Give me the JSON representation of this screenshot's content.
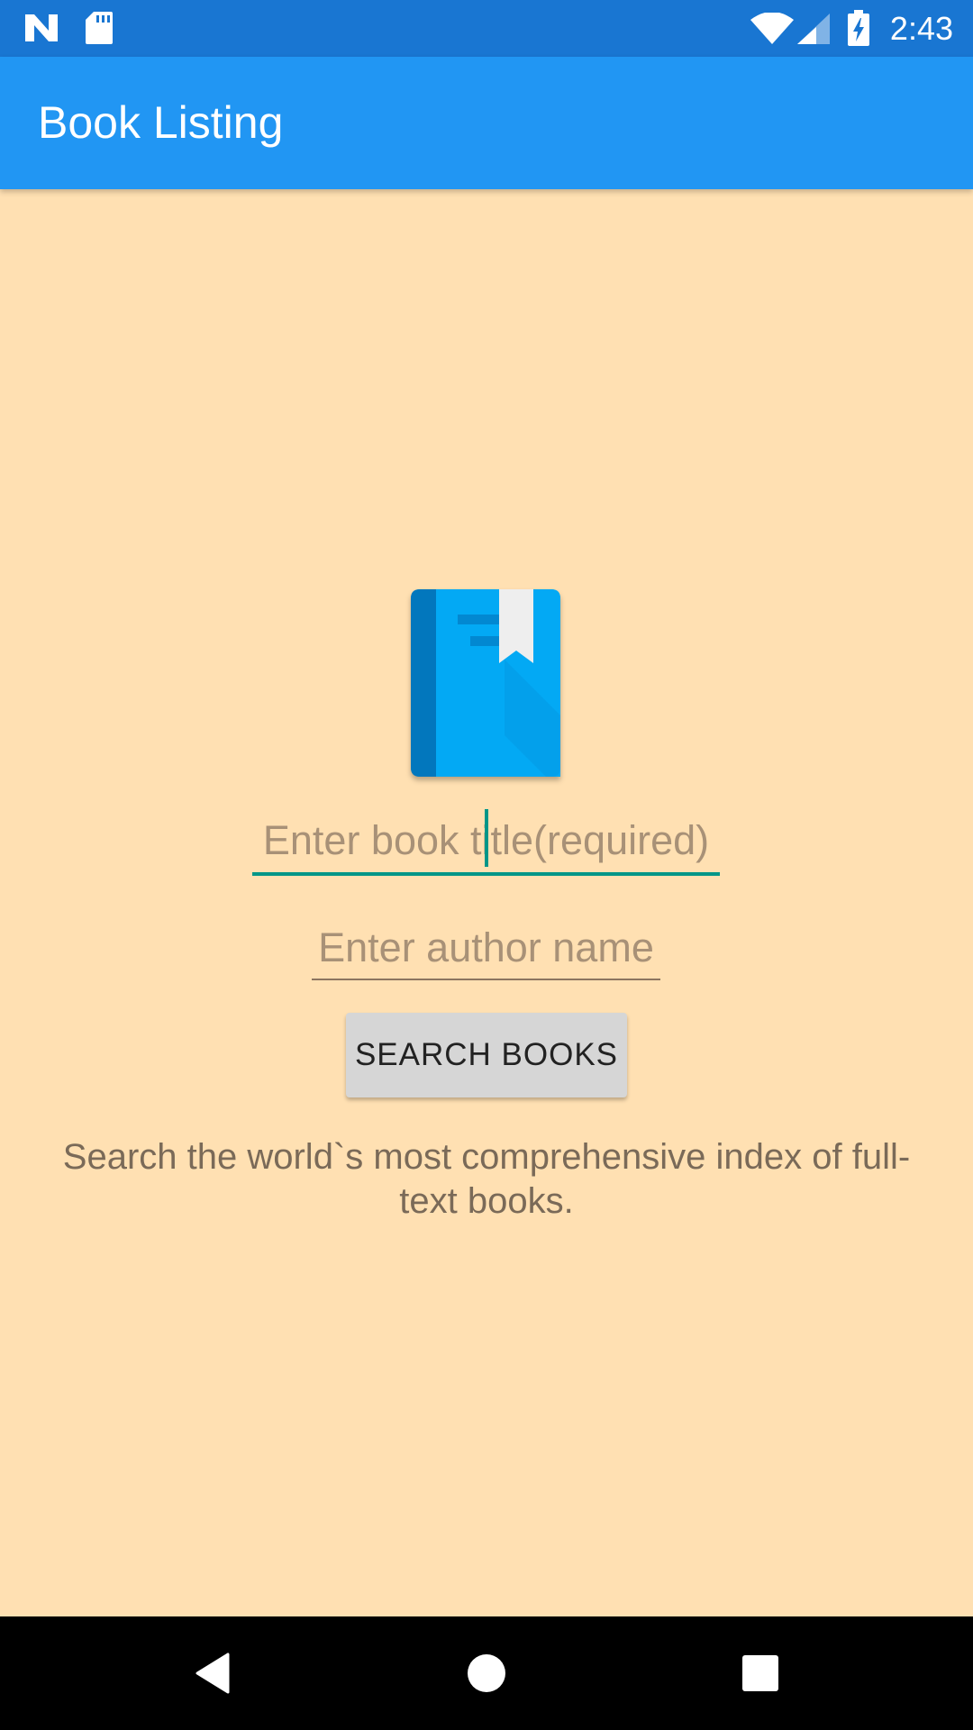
{
  "status_bar": {
    "time": "2:43",
    "icons": [
      "n-notification-icon",
      "sd-card-icon",
      "wifi-icon",
      "cell-signal-icon",
      "battery-charging-icon"
    ]
  },
  "app_bar": {
    "title": "Book Listing",
    "background_color": "#2196F3"
  },
  "main": {
    "logo_icon": "book-icon",
    "title_input": {
      "placeholder": "Enter book title(required)",
      "value": ""
    },
    "author_input": {
      "placeholder": "Enter author name",
      "value": ""
    },
    "search_button_label": "SEARCH BOOKS",
    "description": "Search the world`s most comprehensive index of full-text books.",
    "background_color": "#FFE0B2",
    "accent_color": "#009688"
  },
  "nav_bar": {
    "buttons": [
      "back-icon",
      "home-icon",
      "recents-icon"
    ]
  }
}
